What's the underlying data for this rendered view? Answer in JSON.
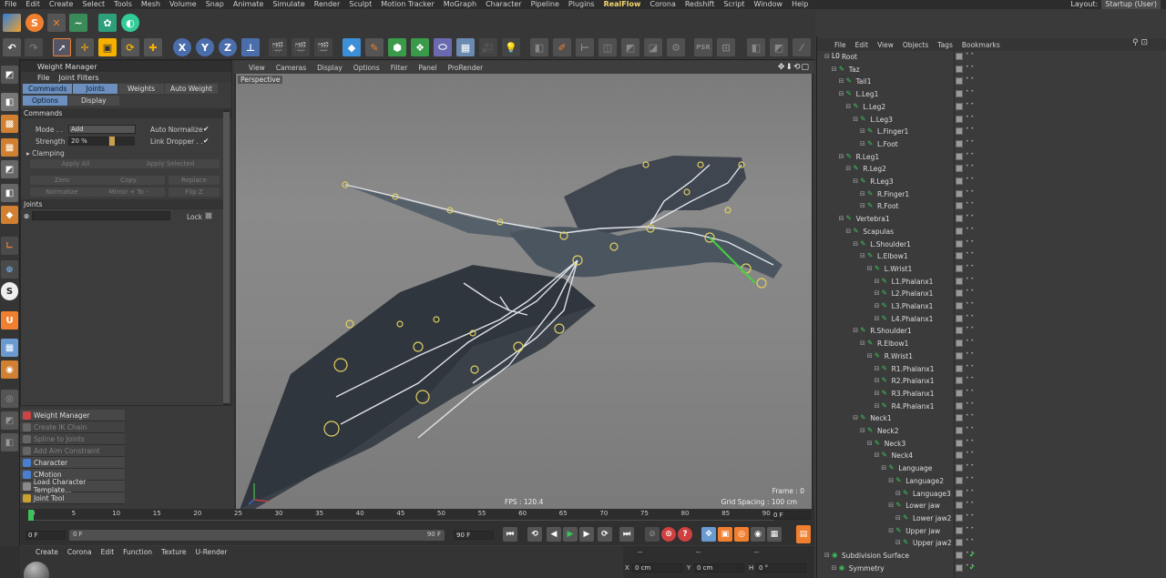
{
  "menubar": {
    "items": [
      "File",
      "Edit",
      "Create",
      "Select",
      "Tools",
      "Mesh",
      "Volume",
      "Snap",
      "Animate",
      "Simulate",
      "Render",
      "Sculpt",
      "Motion Tracker",
      "MoGraph",
      "Character",
      "Pipeline",
      "Plugins",
      "RealFlow",
      "Corona",
      "Redshift",
      "Script",
      "Window",
      "Help"
    ],
    "layout_label": "Layout:",
    "layout_value": "Startup (User)"
  },
  "weight_manager": {
    "title": "Weight Manager",
    "menu": [
      "File",
      "Joint Filters"
    ],
    "tabs_row1": [
      "Commands",
      "Joints",
      "Weights",
      "Auto Weight"
    ],
    "tabs_row2": [
      "Options",
      "Display"
    ],
    "section_commands": "Commands",
    "mode_label": "Mode . .",
    "mode_value": "Add",
    "auto_normalize": "Auto Normalize",
    "strength_label": "Strength",
    "strength_value": "20 %",
    "link_dropper": "Link Dropper . .",
    "clamping": "Clamping",
    "apply_all": "Apply All",
    "apply_selected": "Apply Selected",
    "zero": "Zero",
    "copy": "Copy",
    "replace": "Replace",
    "normalize": "Normalize",
    "mirror": "Mirror + To -",
    "flip": "Flip Z",
    "joints_section": "Joints",
    "lock": "Lock"
  },
  "tool_list": [
    {
      "label": "Weight Manager",
      "dim": false,
      "color": "#c44"
    },
    {
      "label": "Create IK Chain",
      "dim": true,
      "color": "#666"
    },
    {
      "label": "Spline to Joints",
      "dim": true,
      "color": "#666"
    },
    {
      "label": "Add Aim Constraint",
      "dim": true,
      "color": "#666"
    },
    {
      "label": "Character",
      "dim": false,
      "color": "#4a7fd0"
    },
    {
      "label": "CMotion",
      "dim": false,
      "color": "#4a7fd0"
    },
    {
      "label": "Load Character Template...",
      "dim": false,
      "color": "#8a8a8a"
    },
    {
      "label": "Joint Tool",
      "dim": false,
      "color": "#c8a030"
    }
  ],
  "viewport": {
    "menu": [
      "View",
      "Cameras",
      "Display",
      "Options",
      "Filter",
      "Panel",
      "ProRender"
    ],
    "nav_icons": "✥⬇⟲▢",
    "camera": "Perspective",
    "fps": "FPS : 120.4",
    "frame": "Frame : 0",
    "grid_spacing": "Grid Spacing : 100 cm"
  },
  "timeline": {
    "ticks": [
      "0",
      "5",
      "10",
      "15",
      "20",
      "25",
      "30",
      "35",
      "40",
      "45",
      "50",
      "55",
      "60",
      "65",
      "70",
      "75",
      "80",
      "85",
      "90"
    ],
    "end_field": "0 F",
    "start_field": "0 F",
    "current_field": "0 F",
    "max_field": "90 F",
    "max_field2": "90 F"
  },
  "bottom_panel": {
    "menu": [
      "Create",
      "Corona",
      "Edit",
      "Function",
      "Texture",
      "U-Render"
    ],
    "coord_x": "X",
    "coord_x_val": "0 cm",
    "coord_y": "Y",
    "coord_y_val": "0 cm",
    "coord_h": "H",
    "coord_h_val": "0 °",
    "dash": "--"
  },
  "object_manager": {
    "menu": [
      "File",
      "Edit",
      "View",
      "Objects",
      "Tags",
      "Bookmarks"
    ],
    "rows": [
      {
        "name": "Root",
        "depth": 0,
        "icon": "null"
      },
      {
        "name": "Taz",
        "depth": 1,
        "icon": "bone"
      },
      {
        "name": "Tail1",
        "depth": 2,
        "icon": "bone"
      },
      {
        "name": "L.Leg1",
        "depth": 2,
        "icon": "bone"
      },
      {
        "name": "L.Leg2",
        "depth": 3,
        "icon": "bone"
      },
      {
        "name": "L.Leg3",
        "depth": 4,
        "icon": "bone"
      },
      {
        "name": "L.Finger1",
        "depth": 5,
        "icon": "bone"
      },
      {
        "name": "L.Foot",
        "depth": 5,
        "icon": "bone"
      },
      {
        "name": "R.Leg1",
        "depth": 2,
        "icon": "bone"
      },
      {
        "name": "R.Leg2",
        "depth": 3,
        "icon": "bone"
      },
      {
        "name": "R.Leg3",
        "depth": 4,
        "icon": "bone"
      },
      {
        "name": "R.Finger1",
        "depth": 5,
        "icon": "bone"
      },
      {
        "name": "R.Foot",
        "depth": 5,
        "icon": "bone"
      },
      {
        "name": "Vertebra1",
        "depth": 2,
        "icon": "bone"
      },
      {
        "name": "Scapulas",
        "depth": 3,
        "icon": "bone"
      },
      {
        "name": "L.Shoulder1",
        "depth": 4,
        "icon": "bone"
      },
      {
        "name": "L.Elbow1",
        "depth": 5,
        "icon": "bone"
      },
      {
        "name": "L.Wrist1",
        "depth": 6,
        "icon": "bone"
      },
      {
        "name": "L1.Phalanx1",
        "depth": 7,
        "icon": "bone"
      },
      {
        "name": "L2.Phalanx1",
        "depth": 7,
        "icon": "bone"
      },
      {
        "name": "L3.Phalanx1",
        "depth": 7,
        "icon": "bone"
      },
      {
        "name": "L4.Phalanx1",
        "depth": 7,
        "icon": "bone"
      },
      {
        "name": "R.Shoulder1",
        "depth": 4,
        "icon": "bone"
      },
      {
        "name": "R.Elbow1",
        "depth": 5,
        "icon": "bone"
      },
      {
        "name": "R.Wrist1",
        "depth": 6,
        "icon": "bone"
      },
      {
        "name": "R1.Phalanx1",
        "depth": 7,
        "icon": "bone"
      },
      {
        "name": "R2.Phalanx1",
        "depth": 7,
        "icon": "bone"
      },
      {
        "name": "R3.Phalanx1",
        "depth": 7,
        "icon": "bone"
      },
      {
        "name": "R4.Phalanx1",
        "depth": 7,
        "icon": "bone"
      },
      {
        "name": "Neck1",
        "depth": 4,
        "icon": "bone"
      },
      {
        "name": "Neck2",
        "depth": 5,
        "icon": "bone"
      },
      {
        "name": "Neck3",
        "depth": 6,
        "icon": "bone"
      },
      {
        "name": "Neck4",
        "depth": 7,
        "icon": "bone"
      },
      {
        "name": "Language",
        "depth": 8,
        "icon": "bone"
      },
      {
        "name": "Language2",
        "depth": 9,
        "icon": "bone"
      },
      {
        "name": "Language3",
        "depth": 10,
        "icon": "bone"
      },
      {
        "name": "Lower jaw",
        "depth": 9,
        "icon": "bone"
      },
      {
        "name": "Lower jaw2",
        "depth": 10,
        "icon": "bone"
      },
      {
        "name": "Upper jaw",
        "depth": 9,
        "icon": "bone"
      },
      {
        "name": "Upper jaw2",
        "depth": 10,
        "icon": "bone"
      },
      {
        "name": "Subdivision Surface",
        "depth": 0,
        "icon": "sds"
      },
      {
        "name": "Symmetry",
        "depth": 1,
        "icon": "sym"
      }
    ]
  },
  "colors": {
    "accent": "#6b8fbf",
    "realflow": "#f5d76e",
    "bone": "#3cc35a",
    "check": "#3ad04e"
  }
}
